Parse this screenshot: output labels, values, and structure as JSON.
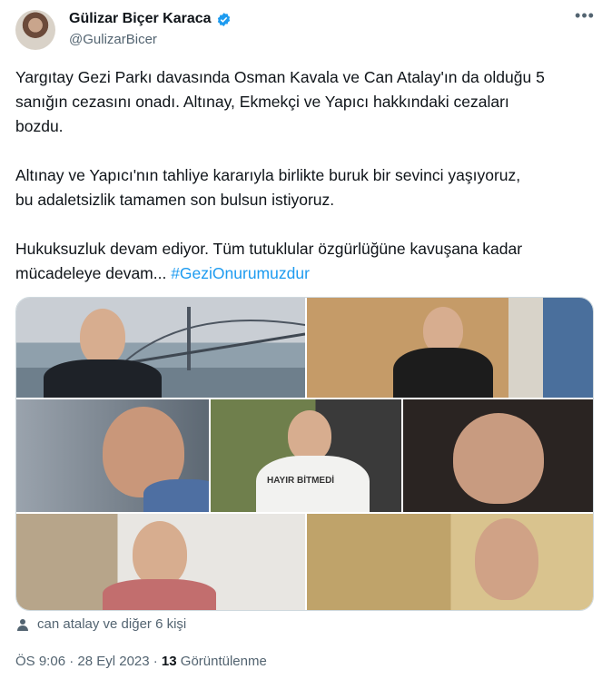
{
  "author": {
    "name": "Gülizar Biçer Karaca",
    "handle": "@GulizarBicer",
    "verified_color": "#1d9bf0"
  },
  "tweet": {
    "paragraph1": "Yargıtay Gezi Parkı davasında Osman Kavala ve Can Atalay'ın da olduğu 5\nsanığın cezasını onadı. Altınay, Ekmekçi ve Yapıcı hakkındaki cezaları\nbozdu.",
    "paragraph2": "Altınay ve Yapıcı'nın tahliye kararıyla birlikte buruk bir sevinci yaşıyoruz,\nbu adaletsizlik tamamen son bulsun istiyoruz.",
    "paragraph3": "Hukuksuzluk devam ediyor. Tüm tutuklular özgürlüğüne kavuşana kadar\nmücadeleye devam... ",
    "hashtag": "#GeziOnurumuzdur"
  },
  "photo_shirt_text": "HAYIR BİTMEDİ",
  "liked_by": "can atalay ve diğer 6 kişi",
  "meta": {
    "time_date": "ÖS 9:06 · 28 Eyl 2023 · ",
    "views_count": "13",
    "views_label": " Görüntülenme"
  },
  "icons": [
    "verified-badge-icon",
    "more-options-icon",
    "person-icon"
  ]
}
